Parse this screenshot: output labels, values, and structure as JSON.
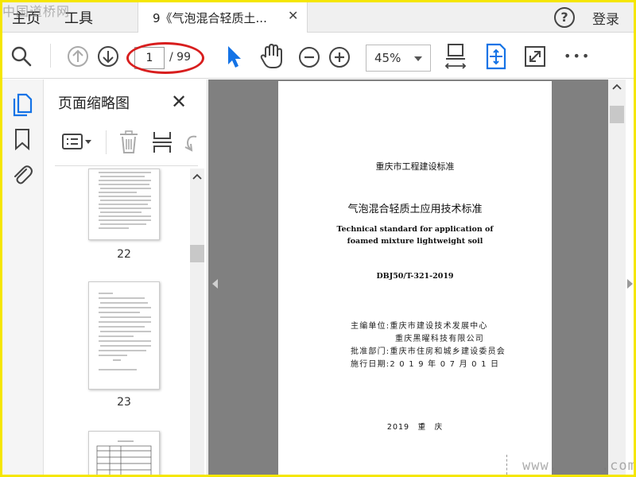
{
  "watermark_top": "中国道桥网",
  "tabs": {
    "home": "主页",
    "tools": "工具",
    "document_title": "9《气泡混合轻质土...",
    "close": "✕"
  },
  "header": {
    "help": "?",
    "login": "登录"
  },
  "toolbar": {
    "page_current": "1",
    "page_total": "/ 99",
    "zoom": "45%",
    "more": "•••"
  },
  "thumbnail_panel": {
    "title": "页面缩略图",
    "close": "✕",
    "pages": [
      {
        "label": "22"
      },
      {
        "label": "23"
      }
    ]
  },
  "document_page": {
    "category": "重庆市工程建设标准",
    "title_cn": "气泡混合轻质土应用技术标准",
    "title_en_line1": "Technical standard for application of",
    "title_en_line2": "foamed mixture lightweight soil",
    "code": "DBJ50/T-321-2019",
    "info_lines": [
      "主编单位:重庆市建设技术发展中心",
      "　　　　　重庆黑曜科技有限公司",
      "批准部门:重庆市住房和城乡建设委员会",
      "施行日期:2 0 1 9 年 0 7 月 0 1 日"
    ],
    "footer": "2019　重　庆"
  },
  "watermark_bottom": "www.　　　.com",
  "colors": {
    "frame": "#f5e600",
    "doc_background": "#808080",
    "accent_blue": "#1473e6",
    "highlight": "#d81e1e"
  }
}
